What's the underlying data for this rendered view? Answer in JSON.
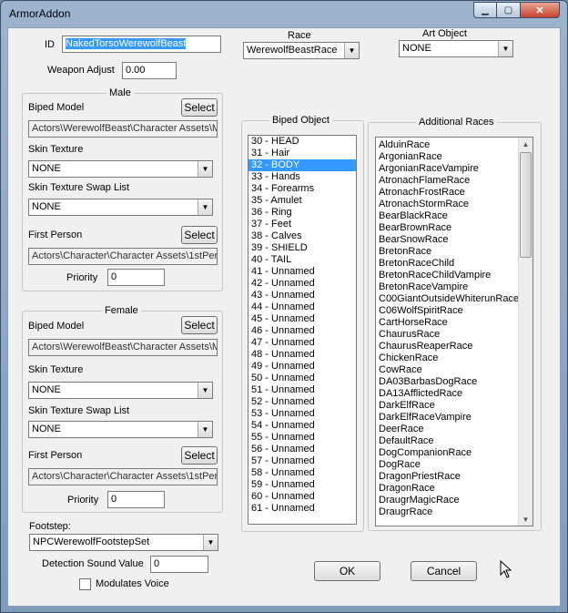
{
  "window": {
    "title": "ArmorAddon"
  },
  "id": {
    "label": "ID",
    "value": "NakedTorsoWerewolfBeast"
  },
  "weapon_adjust": {
    "label": "Weapon Adjust",
    "value": "0.00"
  },
  "race": {
    "label": "Race",
    "value": "WerewolfBeastRace"
  },
  "art_object": {
    "label": "Art Object",
    "value": "NONE"
  },
  "male": {
    "title": "Male",
    "biped_model_label": "Biped Model",
    "select_label": "Select",
    "biped_model_path": "Actors\\WerewolfBeast\\Character Assets\\M",
    "skin_texture_label": "Skin Texture",
    "skin_texture_value": "NONE",
    "swap_list_label": "Skin Texture Swap List",
    "swap_list_value": "NONE",
    "first_person_label": "First Person",
    "first_person_path": "Actors\\Character\\Character Assets\\1stPers",
    "priority_label": "Priority",
    "priority_value": "0"
  },
  "female": {
    "title": "Female",
    "biped_model_label": "Biped Model",
    "select_label": "Select",
    "biped_model_path": "Actors\\WerewolfBeast\\Character Assets\\M",
    "skin_texture_label": "Skin Texture",
    "skin_texture_value": "NONE",
    "swap_list_label": "Skin Texture Swap List",
    "swap_list_value": "NONE",
    "first_person_label": "First Person",
    "first_person_path": "Actors\\Character\\Character Assets\\1stPers",
    "priority_label": "Priority",
    "priority_value": "0"
  },
  "footstep": {
    "label": "Footstep:",
    "value": "NPCWerewolfFootstepSet"
  },
  "detection": {
    "label": "Detection Sound Value",
    "value": "0"
  },
  "modulates_voice": {
    "label": "Modulates Voice",
    "checked": false
  },
  "biped_object": {
    "title": "Biped Object",
    "selected": "32 - BODY",
    "items": [
      "30 - HEAD",
      "31 - Hair",
      "32 - BODY",
      "33 - Hands",
      "34 - Forearms",
      "35 - Amulet",
      "36 - Ring",
      "37 - Feet",
      "38 - Calves",
      "39 - SHIELD",
      "40 - TAIL",
      "41 - Unnamed",
      "42 - Unnamed",
      "43 - Unnamed",
      "44 - Unnamed",
      "45 - Unnamed",
      "46 - Unnamed",
      "47 - Unnamed",
      "48 - Unnamed",
      "49 - Unnamed",
      "50 - Unnamed",
      "51 - Unnamed",
      "52 - Unnamed",
      "53 - Unnamed",
      "54 - Unnamed",
      "55 - Unnamed",
      "56 - Unnamed",
      "57 - Unnamed",
      "58 - Unnamed",
      "59 - Unnamed",
      "60 - Unnamed",
      "61 - Unnamed"
    ]
  },
  "additional_races": {
    "title": "Additional Races",
    "items": [
      "AlduinRace",
      "ArgonianRace",
      "ArgonianRaceVampire",
      "AtronachFlameRace",
      "AtronachFrostRace",
      "AtronachStormRace",
      "BearBlackRace",
      "BearBrownRace",
      "BearSnowRace",
      "BretonRace",
      "BretonRaceChild",
      "BretonRaceChildVampire",
      "BretonRaceVampire",
      "C00GiantOutsideWhiterunRace",
      "C06WolfSpiritRace",
      "CartHorseRace",
      "ChaurusRace",
      "ChaurusReaperRace",
      "ChickenRace",
      "CowRace",
      "DA03BarbasDogRace",
      "DA13AfflictedRace",
      "DarkElfRace",
      "DarkElfRaceVampire",
      "DeerRace",
      "DefaultRace",
      "DogCompanionRace",
      "DogRace",
      "DragonPriestRace",
      "DragonRace",
      "DraugrMagicRace",
      "DraugrRace"
    ]
  },
  "buttons": {
    "ok": "OK",
    "cancel": "Cancel"
  }
}
